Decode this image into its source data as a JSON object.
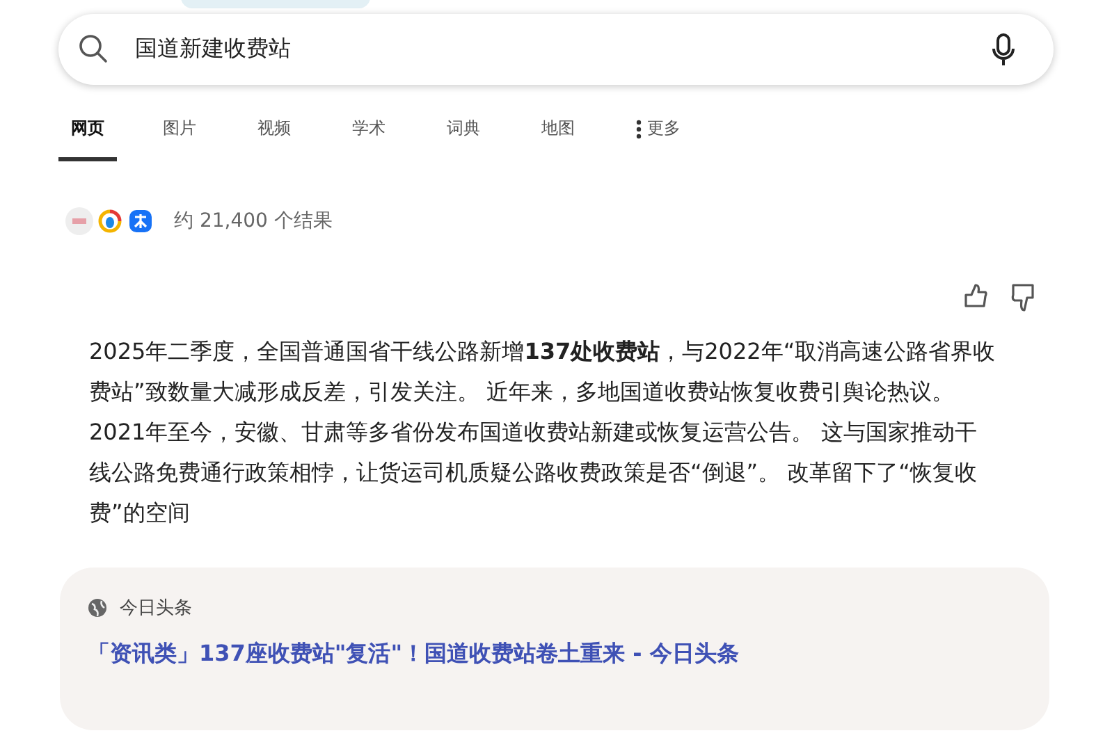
{
  "search": {
    "value": "国道新建收费站"
  },
  "tabs": [
    {
      "label": "网页",
      "selected": true
    },
    {
      "label": "图片",
      "selected": false
    },
    {
      "label": "视频",
      "selected": false
    },
    {
      "label": "学术",
      "selected": false
    },
    {
      "label": "词典",
      "selected": false
    },
    {
      "label": "地图",
      "selected": false
    },
    {
      "label": "更多",
      "selected": false,
      "kind": "more"
    }
  ],
  "result_count": "约 21,400 个结果",
  "answer": {
    "text": "2025年二季度，全国普通国省干线公路新增**137处收费站**，与2022年“取消高速公路省界收费站”致数量大减形成反差，引发关注。 近年来，多地国道收费站恢复收费引舆论热议。 2021年至今，安徽、甘肃等多省份发布国道收费站新建或恢复运营公告。 这与国家推动干线公路免费通行政策相悖，让货运司机质疑公路收费政策是否“倒退”。 改革留下了“恢复收费”的空间"
  },
  "source_card": {
    "source": "今日头条",
    "title": "「资讯类」137座收费站\"复活\"！国道收费站卷土重来 - 今日头条"
  }
}
